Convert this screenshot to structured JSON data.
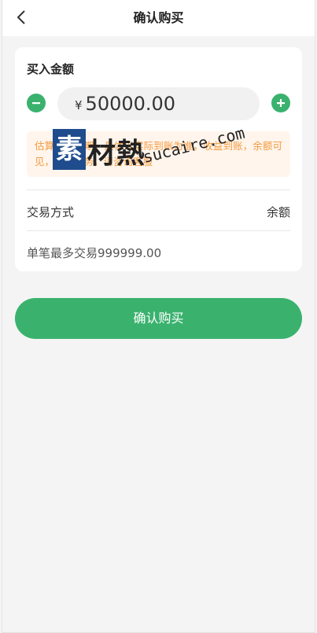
{
  "header": {
    "title": "确认购买",
    "back_icon": "chevron-left-icon"
  },
  "purchase": {
    "section_label": "买入金额",
    "currency_symbol": "¥",
    "amount": "50000.00",
    "minus_icon": "minus-icon",
    "plus_icon": "plus-icon",
    "notice": "估算收益日期，具体以实际到账为准，收益到账，余额可见，售后服务，请咨询客服",
    "method_label": "交易方式",
    "method_value": "余额",
    "limit_text": "单笔最多交易999999.00"
  },
  "actions": {
    "confirm_label": "确认购买"
  },
  "watermark": {
    "block_char": "素",
    "chars": "材熱",
    "url": "sucaire.com"
  },
  "colors": {
    "accent": "#3ab26e",
    "notice_bg": "#fff5ec",
    "notice_text": "#f39a3e",
    "watermark_blue": "#1f4c8c"
  }
}
